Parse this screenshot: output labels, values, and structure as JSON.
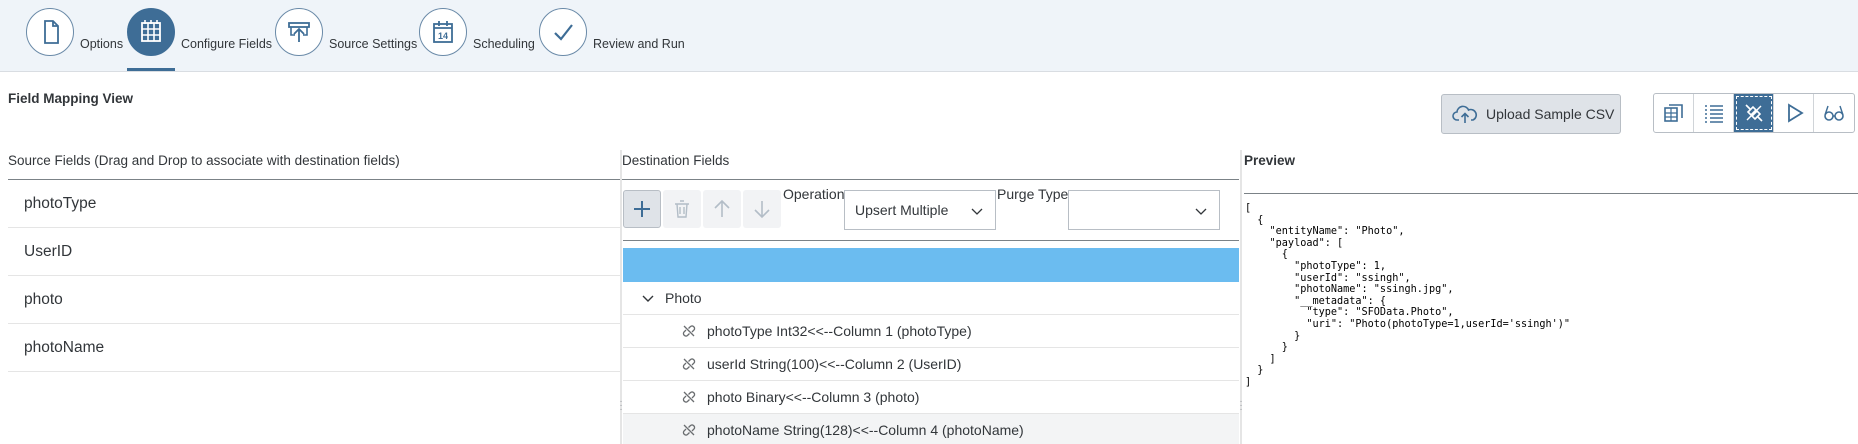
{
  "wizard": {
    "steps": [
      {
        "label": "Options",
        "icon": "document-icon",
        "active": false
      },
      {
        "label": "Configure Fields",
        "icon": "grid-icon",
        "active": true
      },
      {
        "label": "Source Settings",
        "icon": "upload-screen-icon",
        "active": false
      },
      {
        "label": "Scheduling",
        "icon": "calendar-icon",
        "calendar_day": "14",
        "active": false
      },
      {
        "label": "Review and Run",
        "icon": "checkmark-icon",
        "active": false
      }
    ]
  },
  "section_title": "Field Mapping View",
  "toolbar": {
    "upload_label": "Upload Sample CSV",
    "view_buttons": [
      {
        "icon": "table-view-icon",
        "active": false
      },
      {
        "icon": "list-view-icon",
        "active": false
      },
      {
        "icon": "mapping-view-icon",
        "active": true
      },
      {
        "icon": "play-icon",
        "active": false
      },
      {
        "icon": "preview-glasses-icon",
        "active": false
      }
    ]
  },
  "source": {
    "header": "Source Fields (Drag and Drop to associate with destination fields)",
    "items": [
      "photoType",
      "UserID",
      "photo",
      "photoName"
    ]
  },
  "destination": {
    "header": "Destination Fields",
    "operation_label": "Operation",
    "operation_value": "Upsert Multiple",
    "purge_label": "Purge Type",
    "purge_value": "",
    "tree": {
      "node_label": "Photo",
      "leaves": [
        "photoType Int32<<--Column 1 (photoType)",
        "userId String(100)<<--Column 2 (UserID)",
        "photo Binary<<--Column 3 (photo)",
        "photoName String(128)<<--Column 4 (photoName)"
      ]
    }
  },
  "preview": {
    "header": "Preview",
    "json_text": "[\n  {\n    \"entityName\": \"Photo\",\n    \"payload\": [\n      {\n        \"photoType\": 1,\n        \"userId\": \"ssingh\",\n        \"photoName\": \"ssingh.jpg\",\n        \"__metadata\": {\n          \"type\": \"SFOData.Photo\",\n          \"uri\": \"Photo(photoType=1,userId='ssingh')\"\n        }\n      }\n    ]\n  }\n]"
  },
  "colors": {
    "accent": "#3e6d96",
    "header_bg": "#eff4f9",
    "selected_row": "#6bbcf0"
  }
}
